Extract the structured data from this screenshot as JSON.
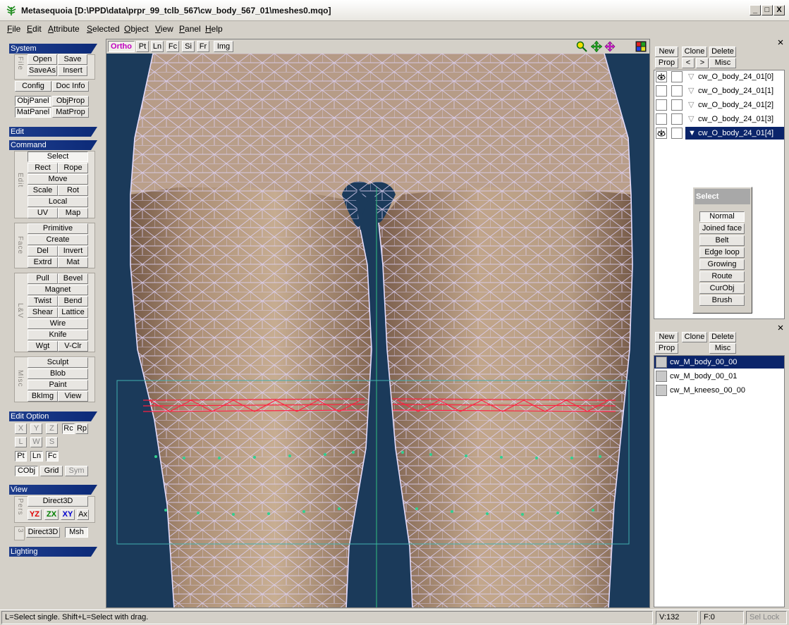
{
  "window": {
    "title": "Metasequoia [D:\\PPD\\data\\prpr_99_tclb_567\\cw_body_567_01\\meshes0.mqo]",
    "min_label": "_",
    "max_label": "□",
    "close_label": "X"
  },
  "menu": [
    {
      "pre": "",
      "u": "F",
      "post": "ile"
    },
    {
      "pre": "",
      "u": "E",
      "post": "dit"
    },
    {
      "pre": "",
      "u": "A",
      "post": "ttribute"
    },
    {
      "pre": "",
      "u": "S",
      "post": "elected"
    },
    {
      "pre": "",
      "u": "O",
      "post": "bject"
    },
    {
      "pre": "",
      "u": "V",
      "post": "iew"
    },
    {
      "pre": "",
      "u": "P",
      "post": "anel"
    },
    {
      "pre": "",
      "u": "H",
      "post": "elp"
    }
  ],
  "left": {
    "system": {
      "header": "System",
      "file_label": "File",
      "open": "Open",
      "save": "Save",
      "saveas": "SaveAs",
      "insert": "Insert",
      "config": "Config",
      "docinfo": "Doc Info",
      "objpanel": "ObjPanel",
      "objprop": "ObjProp",
      "matpanel": "MatPanel",
      "matprop": "MatProp"
    },
    "edit_header": "Edit",
    "command": {
      "header": "Command",
      "edit_label": "Edit",
      "select": "Select",
      "rect": "Rect",
      "rope": "Rope",
      "move": "Move",
      "scale": "Scale",
      "rot": "Rot",
      "local": "Local",
      "uv": "UV",
      "map": "Map",
      "face_label": "Face",
      "primitive": "Primitive",
      "create": "Create",
      "del": "Del",
      "invert": "Invert",
      "extrd": "Extrd",
      "mat": "Mat",
      "lv_label": "L&V",
      "pull": "Pull",
      "bevel": "Bevel",
      "magnet": "Magnet",
      "twist": "Twist",
      "bend": "Bend",
      "shear": "Shear",
      "lattice": "Lattice",
      "wire": "Wire",
      "knife": "Knife",
      "wgt": "Wgt",
      "vclr": "V-Clr",
      "misc_label": "Misc",
      "sculpt": "Sculpt",
      "blob": "Blob",
      "paint": "Paint",
      "bkimg": "BkImg",
      "view": "View"
    },
    "editoption": {
      "header": "Edit Option",
      "x": "X",
      "y": "Y",
      "z": "Z",
      "rc": "Rc",
      "rp": "Rp",
      "l": "L",
      "w": "W",
      "s": "S",
      "pt": "Pt",
      "ln": "Ln",
      "fc": "Fc",
      "cobj": "CObj",
      "grid": "Grid",
      "sym": "Sym"
    },
    "view": {
      "header": "View",
      "pers_label": "Pers",
      "direct3d": "Direct3D",
      "yz": "YZ",
      "zx": "ZX",
      "xy": "XY",
      "ax": "Ax",
      "three_label": "3",
      "direct3d_2": "Direct3D",
      "msh": "Msh"
    },
    "lighting_header": "Lighting"
  },
  "viewport": {
    "ortho": "Ortho",
    "pt": "Pt",
    "ln": "Ln",
    "fc": "Fc",
    "si": "Si",
    "fr": "Fr",
    "img": "Img"
  },
  "objects": {
    "new": "New",
    "clone": "Clone",
    "delete": "Delete",
    "prop": "Prop",
    "prev": "<",
    "next": ">",
    "misc": "Misc",
    "items": [
      {
        "name": "cw_O_body_24_01[0]",
        "visible": true,
        "selected": false,
        "expanded": false
      },
      {
        "name": "cw_O_body_24_01[1]",
        "visible": false,
        "selected": false,
        "expanded": false
      },
      {
        "name": "cw_O_body_24_01[2]",
        "visible": false,
        "selected": false,
        "expanded": false
      },
      {
        "name": "cw_O_body_24_01[3]",
        "visible": false,
        "selected": false,
        "expanded": false
      },
      {
        "name": "cw_O_body_24_01[4]",
        "visible": true,
        "selected": true,
        "expanded": true
      }
    ]
  },
  "select_popup": {
    "title": "Select",
    "items": [
      "Normal",
      "Joined face",
      "Belt",
      "Edge loop",
      "Growing",
      "Route",
      "CurObj",
      "Brush"
    ]
  },
  "materials": {
    "new": "New",
    "clone": "Clone",
    "delete": "Delete",
    "prop": "Prop",
    "misc": "Misc",
    "items": [
      {
        "name": "cw_M_body_00_00",
        "selected": true
      },
      {
        "name": "cw_M_body_00_01",
        "selected": false
      },
      {
        "name": "cw_M_kneeso_00_00",
        "selected": false
      }
    ]
  },
  "status": {
    "hint": "L=Select single.  Shift+L=Select with drag.",
    "vertices": "V:132",
    "faces": "F:0",
    "sellock": "Sel Lock"
  }
}
